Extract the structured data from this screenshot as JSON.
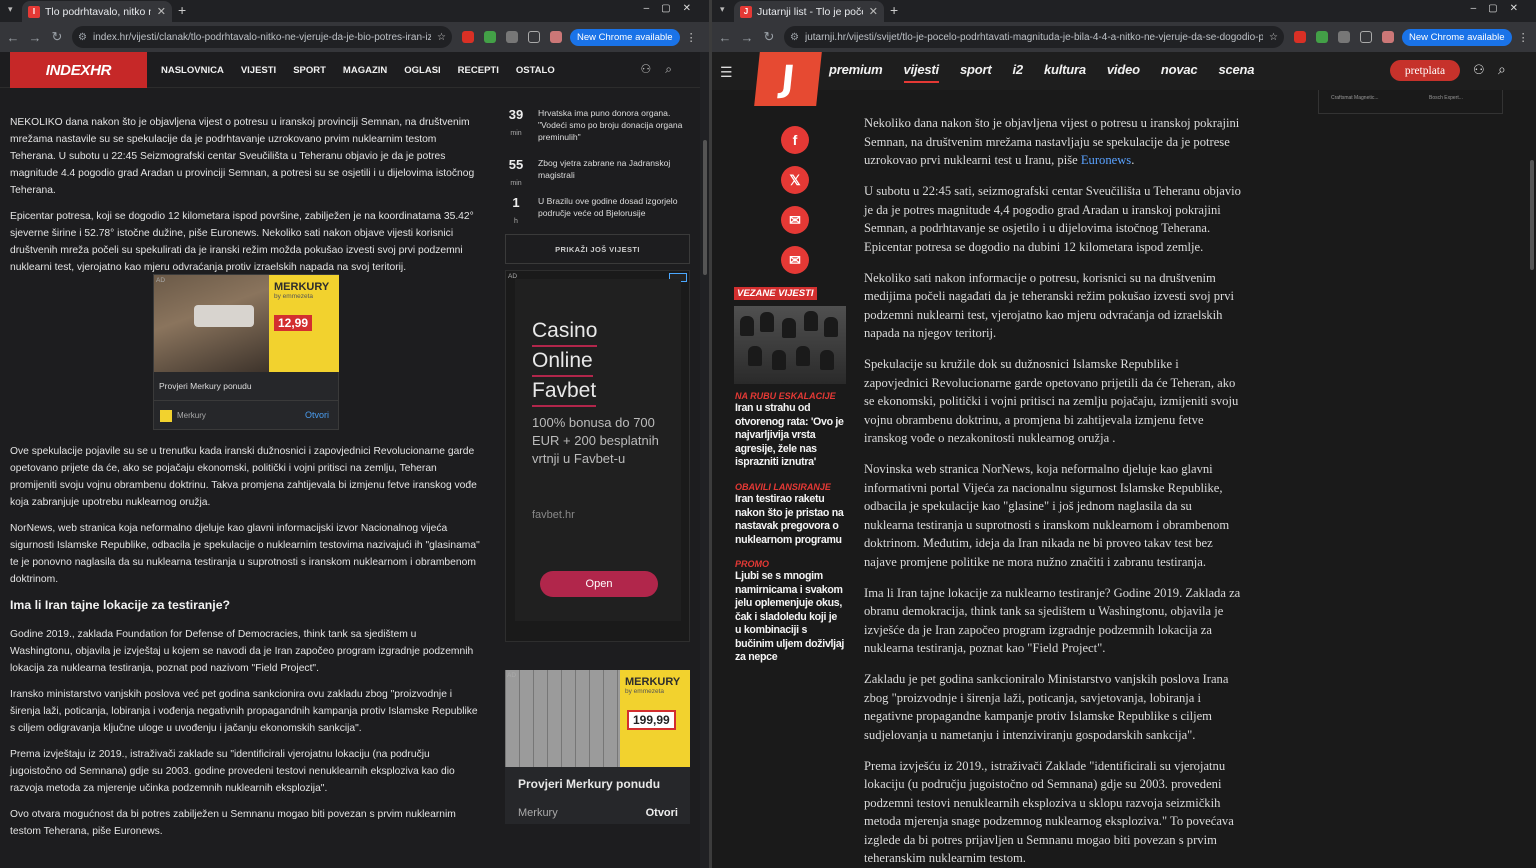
{
  "left": {
    "tab_title": "Tlo podrhtavalo, nitko ne",
    "url": "index.hr/vijesti/clanak/tlo-podrhtavalo-nitko-ne-vjeruje-da-je-bio-potres-iran-izveo-prv...",
    "update_button": "New Chrome available",
    "logo": "INDEXHR",
    "nav": [
      "NASLOVNICA",
      "VIJESTI",
      "SPORT",
      "MAGAZIN",
      "OGLASI",
      "RECEPTI",
      "OSTALO"
    ],
    "paragraphs": [
      "NEKOLIKO dana nakon što je objavljena vijest o potresu u iranskoj provinciji Semnan, na društvenim mrežama nastavile su se spekulacije da je podrhtavanje uzrokovano prvim nuklearnim testom Teherana. U subotu u 22:45 Seizmografski centar Sveučilišta u Teheranu objavio je da je potres magnitude 4.4 pogodio grad Aradan u provinciji Semnan, a potresi su se osjetili i u dijelovima istočnog Teherana.",
      "Epicentar potresa, koji se dogodio 12 kilometara ispod površine, zabilježen je na koordinatama 35.42° sjeverne širine i 52.78° istočne dužine, piše Euronews. Nekoliko sati nakon objave vijesti korisnici društvenih mreža počeli su spekulirati da je iranski režim možda pokušao izvesti svoj prvi podzemni nuklearni test, vjerojatno kao mjeru odvraćanja protiv izraelskih napada na svoj teritorij.",
      "Ove spekulacije pojavile su se u trenutku kada iranski dužnosnici i zapovjednici Revolucionarne garde opetovano prijete da će, ako se pojačaju ekonomski, politički i vojni pritisci na zemlju, Teheran promijeniti svoju vojnu obrambenu doktrinu. Takva promjena zahtijevala bi izmjenu fetve iranskog vođe koja zabranjuje upotrebu nuklearnog oružja.",
      "NorNews, web stranica koja neformalno djeluje kao glavni informacijski izvor Nacionalnog vijeća sigurnosti Islamske Republike, odbacila je spekulacije o nuklearnim testovima nazivajući ih \"glasinama\" te je ponovno naglasila da su nuklearna testiranja u suprotnosti s iranskom nuklearnom i obrambenom doktrinom."
    ],
    "subheading": "Ima li Iran tajne lokacije za testiranje?",
    "paragraphs2": [
      "Godine 2019., zaklada Foundation for Defense of Democracies, think tank sa sjedištem u Washingtonu, objavila je izvještaj u kojem se navodi da je Iran započeo program izgradnje podzemnih lokacija za nuklearna testiranja, poznat pod nazivom \"Field Project\".",
      "Iransko ministarstvo vanjskih poslova već pet godina sankcionira ovu zakladu zbog \"proizvodnje i širenja laži, poticanja, lobiranja i vođenja negativnih propagandnih kampanja protiv Islamske Republike s ciljem odigravanja ključne uloge u uvođenju i jačanju ekonomskih sankcija\".",
      "Prema izvještaju iz 2019., istraživači zaklade su \"identificirali vjerojatnu lokaciju (na području jugoistočno od Semnana) gdje su 2003. godine provedeni testovi nenuklearnih eksploziva kao dio razvoja metoda za mjerenje učinka podzemnih nuklearnih eksplozija\".",
      "Ovo otvara mogućnost da bi potres zabilježen u Semnanu mogao biti povezan s prvim nuklearnim testom Teherana, piše Euronews."
    ],
    "ad1": {
      "tag": "AD",
      "brand": "MERKURY",
      "brand_sub": "by emmezeta",
      "price": "12,99",
      "caption": "Provjeri Merkury ponudu",
      "advertiser": "Merkury",
      "cta": "Otvori"
    },
    "news": [
      {
        "num": "39",
        "unit": "min",
        "text": "Hrvatska ima puno donora organa. \"Vodeći smo po broju donacija organa preminulih\""
      },
      {
        "num": "55",
        "unit": "min",
        "text": "Zbog vjetra zabrane na Jadranskoj magistrali"
      },
      {
        "num": "1",
        "unit": "h",
        "text": "U Brazilu ove godine dosad izgorjelo područje veće od Bjelorusije"
      }
    ],
    "more_news": "PRIKAŽI JOŠ VIJESTI",
    "ad2": {
      "tag": "AD",
      "lines": [
        "Casino",
        "Online",
        "Favbet"
      ],
      "bonus": "100% bonusa do 700 EUR + 200 besplatnih vrtnji u Favbet-u",
      "domain": "favbet.hr",
      "cta": "Open"
    },
    "ad3": {
      "tag": "AD",
      "brand": "MERKURY",
      "brand_sub": "by emmezeta",
      "price": "199,99",
      "caption": "Provjeri Merkury ponudu",
      "advertiser": "Merkury",
      "cta": "Otvori"
    }
  },
  "right": {
    "tab_title": "Jutarnji list - Tlo je počel",
    "url": "jutarnji.hr/vijesti/svijet/tlo-je-pocelo-podrhtavati-magnituda-je-bila-4-4-a-nitko-ne-vjeruje-da-se-dogodio-potre...",
    "update_button": "New Chrome available",
    "logo": "J",
    "nav": [
      "premium",
      "vijesti",
      "sport",
      "i2",
      "kultura",
      "video",
      "novac",
      "scena"
    ],
    "subscribe": "pretplata",
    "related_label": "VEZANE VIJESTI",
    "related": [
      {
        "kicker": "NA RUBU ESKALACIJE",
        "title": "Iran u strahu od otvorenog rata: 'Ovo je najvarljivija vrsta agresije, žele nas isprazniti iznutra'"
      },
      {
        "kicker": "OBAVILI LANSIRANJE",
        "title": "Iran testirao raketu nakon što je pristao na nastavak pregovora o nuklearnom programu"
      },
      {
        "kicker": "PROMO",
        "title": "Ljubi se s mnogim namirnicama i svakom jelu oplemenjuje okus, čak i sladoledu koji je u kombinaciji s bučinim uljem doživljaj za nepce"
      }
    ],
    "top_ad_labels": [
      "Craftsmat Magnetic...",
      "Bosch Expert..."
    ],
    "p1_text": "Nekoliko dana nakon što je objavljena vijest o potresu u iranskoj pokrajini Semnan, na društvenim mrežama nastavljaju se spekulacije da je potrese uzrokovao prvi nuklearni test u Iranu, piše ",
    "p1_link": "Euronews",
    "p1_end": ".",
    "paragraphs": [
      "U subotu u 22:45 sati, seizmografski centar Sveučilišta u Teheranu objavio je da je potres magnitude 4,4 pogodio grad Aradan u iranskoj pokrajini Semnan, a podrhtavanje se osjetilo i u dijelovima istočnog Teherana. Epicentar potresa se dogodio na dubini 12 kilometara ispod zemlje.",
      "Nekoliko sati nakon informacije o potresu, korisnici su na društvenim medijima počeli nagađati da je teheranski režim pokušao izvesti svoj prvi podzemni nuklearni test, vjerojatno kao mjeru odvraćanja od izraelskih napada na njegov teritorij.",
      "Spekulacije su kružile dok su dužnosnici Islamske Republike i zapovjednici Revolucionarne garde opetovano prijetili da će Teheran, ako se ekonomski, politički i vojni pritisci na zemlju pojačaju, izmijeniti svoju vojnu obrambenu doktrinu, a promjena bi zahtijevala izmjenu fetve iranskog vođe o nezakonitosti nuklearnog oružja .",
      "Novinska web stranica NorNews, koja neformalno djeluje kao glavni informativni portal Vijeća za nacionalnu sigurnost Islamske Republike, odbacila je spekulacije kao \"glasine\" i još jednom naglasila da su nuklearna testiranja u suprotnosti s iranskom nuklearnom i obrambenom doktrinom. Međutim, ideja da Iran nikada ne bi proveo takav test bez najave promjene politike ne mora nužno značiti i zabranu testiranja.",
      "Ima li Iran tajne lokacije za nuklearno testiranje? Godine 2019. Zaklada za obranu demokracija, think tank sa sjedištem u Washingtonu, objavila je izvješće da je Iran započeo program izgradnje podzemnih lokacija za nuklearna testiranja, poznat kao \"Field Project\".",
      "Zakladu je pet godina sankcioniralo Ministarstvo vanjskih poslova Irana zbog \"proizvodnje i širenja laži, poticanja, savjetovanja, lobiranja i negativne propagandne kampanje protiv Islamske Republike s ciljem sudjelovanja u nametanju i intenziviranju gospodarskih sankcija\".",
      "Prema izvješću iz 2019., istraživači Zaklade \"identificirali su vjerojatnu lokaciju (u području jugoistočno od Semnana) gdje su 2003. provedeni podzemni testovi nenuklearnih eksploziva u sklopu razvoja seizmičkih metoda mjerenja snage podzemnog nuklearnog eksploziva.\" To povećava izglede da bi potres prijavljen u Semnanu mogao biti povezan s prvim teheranskim nuklearnim testom."
    ]
  }
}
